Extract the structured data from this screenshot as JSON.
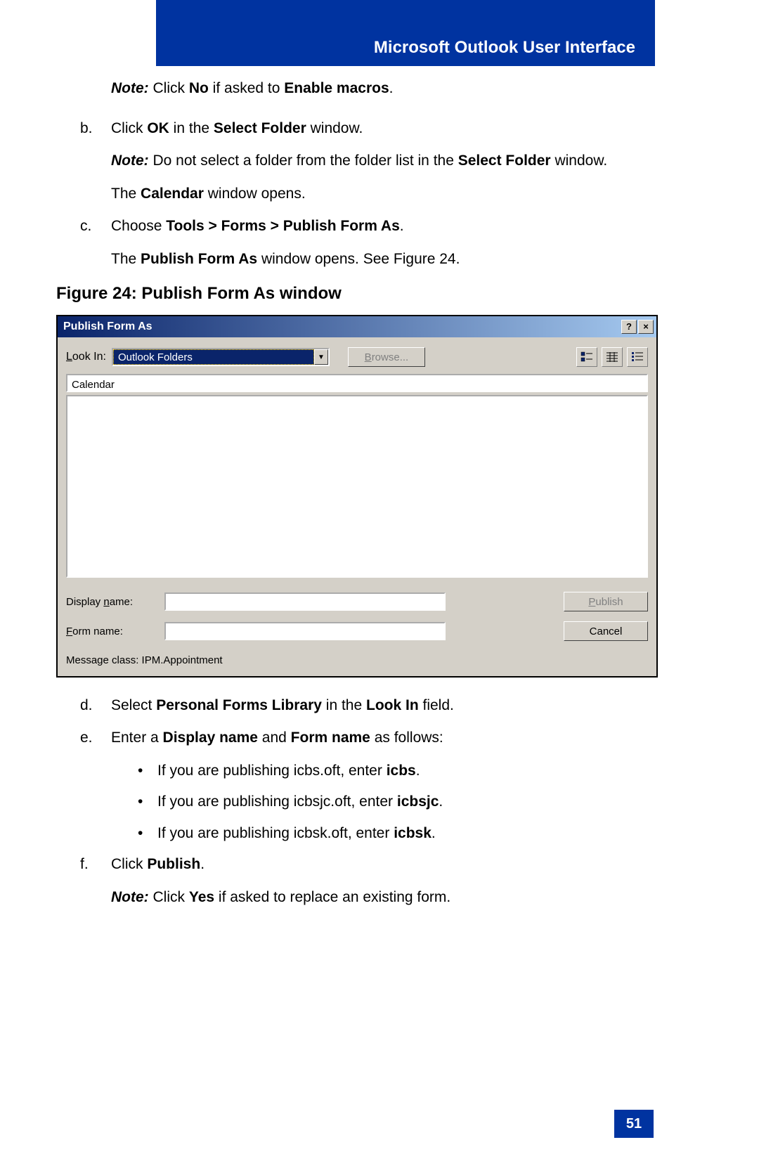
{
  "header": {
    "title": "Microsoft Outlook User Interface"
  },
  "intro_note": {
    "prefix": "Note:",
    "t1": " Click ",
    "b1": "No",
    "t2": " if asked to ",
    "b2": "Enable macros",
    "t3": "."
  },
  "step_b": {
    "letter": "b.",
    "t1": "Click ",
    "b1": "OK",
    "t2": " in the ",
    "b2": "Select Folder",
    "t3": " window.",
    "note_prefix": "Note:",
    "note_t1": " Do not select a folder from the folder list in the ",
    "note_b1": "Select Folder",
    "note_t2": " window.",
    "sub_t1": "The ",
    "sub_b1": "Calendar",
    "sub_t2": " window opens."
  },
  "step_c": {
    "letter": "c.",
    "t1": "Choose ",
    "b1": "Tools > Forms > Publish Form As",
    "t2": ".",
    "sub_t1": "The ",
    "sub_b1": "Publish Form As",
    "sub_t2": " window opens. See Figure 24."
  },
  "figure": {
    "caption": "Figure 24: Publish Form As window"
  },
  "dialog": {
    "title": "Publish Form As",
    "lookin_label": "Look In:",
    "lookin_value": "Outlook Folders",
    "browse_label": "Browse...",
    "calendar_value": "Calendar",
    "display_name_label": "Display name:",
    "form_name_label": "Form name:",
    "publish_label": "Publish",
    "cancel_label": "Cancel",
    "msg_class_label": "Message class:  IPM.Appointment"
  },
  "step_d": {
    "letter": "d.",
    "t1": "Select ",
    "b1": "Personal Forms Library",
    "t2": " in the ",
    "b2": "Look In",
    "t3": " field."
  },
  "step_e": {
    "letter": "e.",
    "t1": "Enter a ",
    "b1": "Display name",
    "t2": " and ",
    "b2": "Form name",
    "t3": " as follows:",
    "bullets": [
      {
        "t1": "If you are publishing icbs.oft, enter ",
        "b1": "icbs",
        "t2": "."
      },
      {
        "t1": "If you are publishing icbsjc.oft, enter ",
        "b1": "icbsjc",
        "t2": "."
      },
      {
        "t1": "If you are publishing icbsk.oft, enter ",
        "b1": "icbsk",
        "t2": "."
      }
    ]
  },
  "step_f": {
    "letter": "f.",
    "t1": "Click ",
    "b1": "Publish",
    "t2": ".",
    "note_prefix": "Note:",
    "note_t1": " Click ",
    "note_b1": "Yes",
    "note_t2": " if asked to replace an existing form."
  },
  "page_number": "51"
}
